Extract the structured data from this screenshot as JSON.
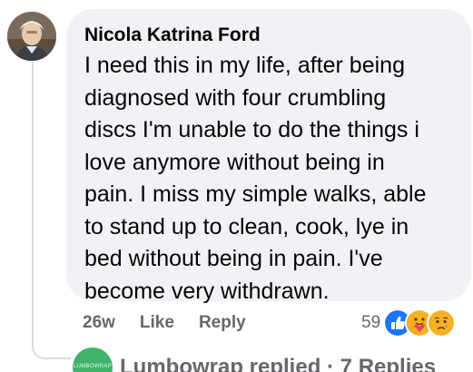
{
  "comment": {
    "author": "Nicola Katrina Ford",
    "text": "I need this in my life, after being\ndiagnosed with four crumbling\ndiscs I'm unable to do the things i\nlove anymore without being in\npain. I miss my simple walks, able\nto stand up to clean, cook, lye in\nbed without being in pain. I've\nbecome very withdrawn.",
    "avatar_icon": "profile-photo",
    "timestamp": "26w",
    "like_label": "Like",
    "reply_label": "Reply",
    "reaction_count": "59",
    "reactions": [
      "like-icon",
      "care-icon",
      "sad-icon"
    ]
  },
  "reply_summary": {
    "avatar_text": "LUMBOWRAP",
    "text": "Lumbowrap replied · 7 Replies"
  },
  "colors": {
    "bubble": "#f0f2f5",
    "like_blue": "#1877f2",
    "reaction_yellow": "#f7b125",
    "secondary_text": "#65676b",
    "brand_green": "#3fb36a"
  }
}
